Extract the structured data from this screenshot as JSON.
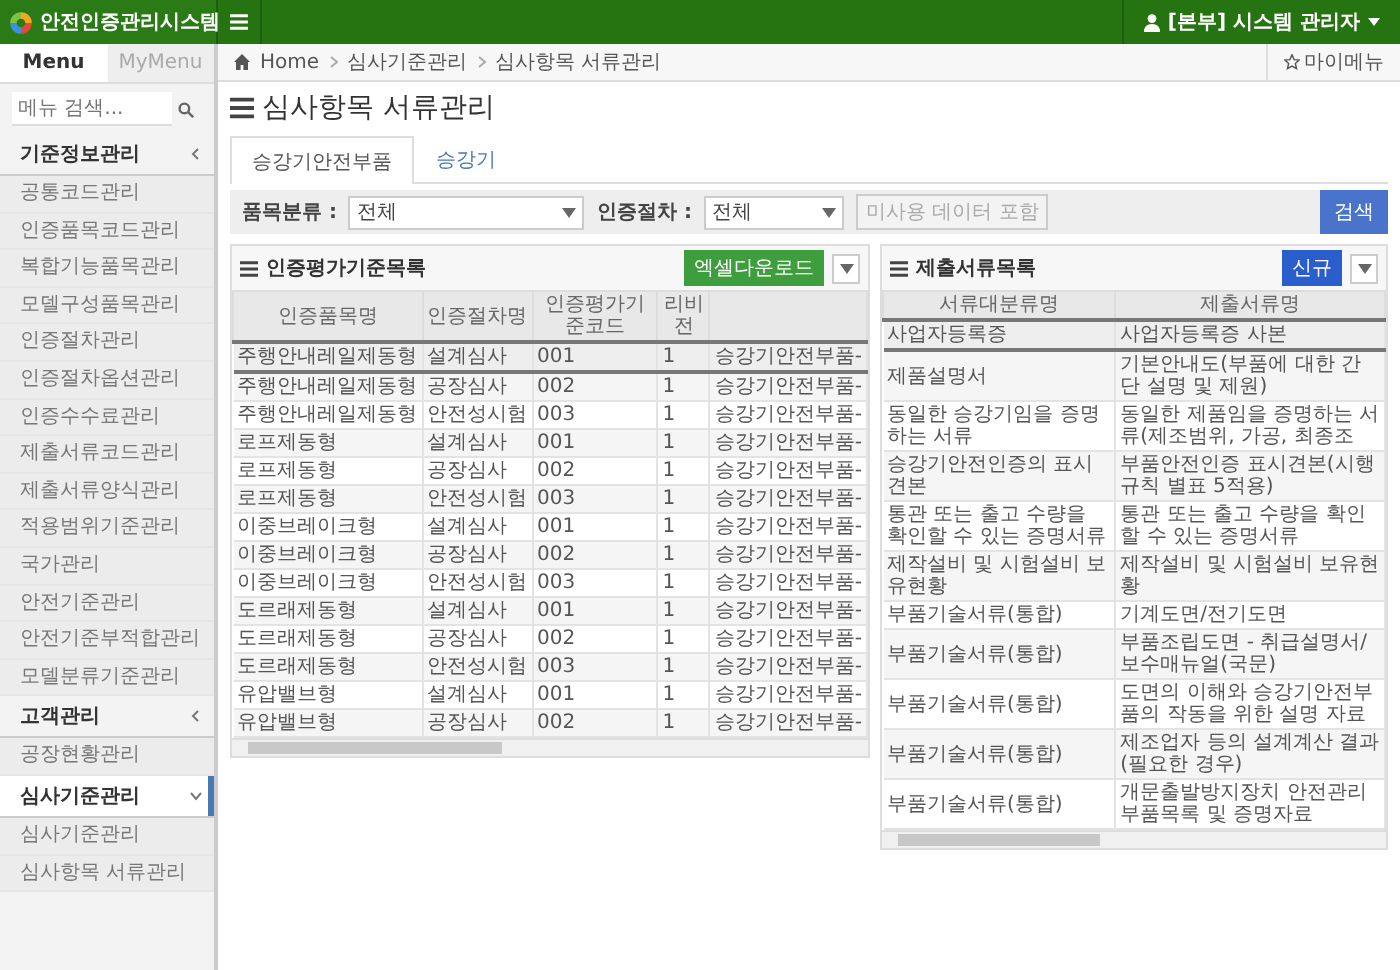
{
  "header": {
    "title": "안전인증관리시스템",
    "user": "[본부] 시스템 관리자"
  },
  "sidebar": {
    "tabs": [
      {
        "label": "Menu",
        "selected": true
      },
      {
        "label": "MyMenu",
        "selected": false
      }
    ],
    "search": {
      "placeholder": "메뉴 검색..."
    },
    "groups": [
      {
        "label": "기준정보관리",
        "expanded": false,
        "selected": false,
        "children": [
          {
            "label": "공통코드관리"
          },
          {
            "label": "인증품목코드관리"
          },
          {
            "label": "복합기능품목관리"
          },
          {
            "label": "모델구성품목관리"
          },
          {
            "label": "인증절차관리"
          },
          {
            "label": "인증절차옵션관리"
          },
          {
            "label": "인증수수료관리"
          },
          {
            "label": "제출서류코드관리"
          },
          {
            "label": "제출서류양식관리"
          },
          {
            "label": "적용범위기준관리"
          },
          {
            "label": "국가관리"
          },
          {
            "label": "안전기준관리"
          },
          {
            "label": "안전기준부적합관리"
          },
          {
            "label": "모델분류기준관리"
          }
        ]
      },
      {
        "label": "고객관리",
        "expanded": false,
        "selected": false,
        "children": [
          {
            "label": "공장현황관리"
          }
        ]
      },
      {
        "label": "심사기준관리",
        "expanded": true,
        "selected": true,
        "children": [
          {
            "label": "심사기준관리"
          },
          {
            "label": "심사항목 서류관리"
          }
        ]
      }
    ]
  },
  "breadcrumb": [
    "Home",
    "심사기준관리",
    "심사항목 서류관리"
  ],
  "my_menu": "마이메뉴",
  "page_title": "심사항목 서류관리",
  "tabs": [
    {
      "label": "승강기안전부품",
      "selected": true
    },
    {
      "label": "승강기",
      "selected": false
    }
  ],
  "filters": [
    {
      "label": "품목분류 :",
      "value": "전체"
    },
    {
      "label": "인증절차 :",
      "value": "전체"
    }
  ],
  "include_unused": {
    "label": "미사용 데이터 포함",
    "checked": false
  },
  "search_button": "검색",
  "left_panel": {
    "title": "인증평가기준목록",
    "button": "엑셀다운로드",
    "table": {
      "columns": [
        "인증품목명",
        "인증절차명",
        "인증평가기준코드",
        "리비전"
      ],
      "rows": [
        {
          "cells": [
            "주행안내레일제동형",
            "설계심사",
            "001",
            "1",
            "승강기안전부품-"
          ],
          "selected": true
        },
        {
          "cells": [
            "주행안내레일제동형",
            "공장심사",
            "002",
            "1",
            "승강기안전부품-"
          ],
          "selected": false
        },
        {
          "cells": [
            "주행안내레일제동형",
            "안전성시험",
            "003",
            "1",
            "승강기안전부품-"
          ],
          "selected": false
        },
        {
          "cells": [
            "로프제동형",
            "설계심사",
            "001",
            "1",
            "승강기안전부품-"
          ],
          "selected": false
        },
        {
          "cells": [
            "로프제동형",
            "공장심사",
            "002",
            "1",
            "승강기안전부품-"
          ],
          "selected": false
        },
        {
          "cells": [
            "로프제동형",
            "안전성시험",
            "003",
            "1",
            "승강기안전부품-"
          ],
          "selected": false
        },
        {
          "cells": [
            "이중브레이크형",
            "설계심사",
            "001",
            "1",
            "승강기안전부품-"
          ],
          "selected": false
        },
        {
          "cells": [
            "이중브레이크형",
            "공장심사",
            "002",
            "1",
            "승강기안전부품-"
          ],
          "selected": false
        },
        {
          "cells": [
            "이중브레이크형",
            "안전성시험",
            "003",
            "1",
            "승강기안전부품-"
          ],
          "selected": false
        },
        {
          "cells": [
            "도르래제동형",
            "설계심사",
            "001",
            "1",
            "승강기안전부품-"
          ],
          "selected": false
        },
        {
          "cells": [
            "도르래제동형",
            "공장심사",
            "002",
            "1",
            "승강기안전부품-"
          ],
          "selected": false
        },
        {
          "cells": [
            "도르래제동형",
            "안전성시험",
            "003",
            "1",
            "승강기안전부품-"
          ],
          "selected": false
        },
        {
          "cells": [
            "유압밸브형",
            "설계심사",
            "001",
            "1",
            "승강기안전부품-"
          ],
          "selected": false
        },
        {
          "cells": [
            "유압밸브형",
            "공장심사",
            "002",
            "1",
            "승강기안전부품-"
          ],
          "selected": false
        }
      ]
    }
  },
  "right_panel": {
    "title": "제출서류목록",
    "button": "신규",
    "table": {
      "columns": [
        "서류대분류명",
        "제출서류명"
      ],
      "rows": [
        {
          "cells": [
            "사업자등록증",
            "사업자등록증 사본"
          ],
          "selected": true
        },
        {
          "cells": [
            "제품설명서",
            "기본안내도(부품에 대한 간단 설명 및 제원)"
          ],
          "selected": false
        },
        {
          "cells": [
            "동일한 승강기임을 증명하는 서류",
            "동일한 제품임을 증명하는 서류(제조범위, 가공, 최종조"
          ],
          "selected": false
        },
        {
          "cells": [
            "승강기안전인증의 표시견본",
            "부품안전인증 표시견본(시행규칙 별표 5적용)"
          ],
          "selected": false
        },
        {
          "cells": [
            "통관 또는 출고 수량을 확인할 수 있는 증명서류",
            "통관 또는 출고 수량을 확인할 수 있는 증명서류"
          ],
          "selected": false
        },
        {
          "cells": [
            "제작설비 및 시험설비 보유현황",
            "제작설비 및 시험설비 보유현황"
          ],
          "selected": false
        },
        {
          "cells": [
            "부품기술서류(통합)",
            "기계도면/전기도면"
          ],
          "selected": false
        },
        {
          "cells": [
            "부품기술서류(통합)",
            "부품조립도면 - 취급설명서/보수매뉴얼(국문)"
          ],
          "selected": false
        },
        {
          "cells": [
            "부품기술서류(통합)",
            "도면의 이해와 승강기안전부품의 작동을 위한 설명 자료"
          ],
          "selected": false
        },
        {
          "cells": [
            "부품기술서류(통합)",
            "제조업자 등의 설계계산 결과(필요한 경우)"
          ],
          "selected": false
        },
        {
          "cells": [
            "부품기술서류(통합)",
            "개문출발방지장치 안전관리부품목록 및 증명자료"
          ],
          "selected": false
        }
      ]
    }
  }
}
